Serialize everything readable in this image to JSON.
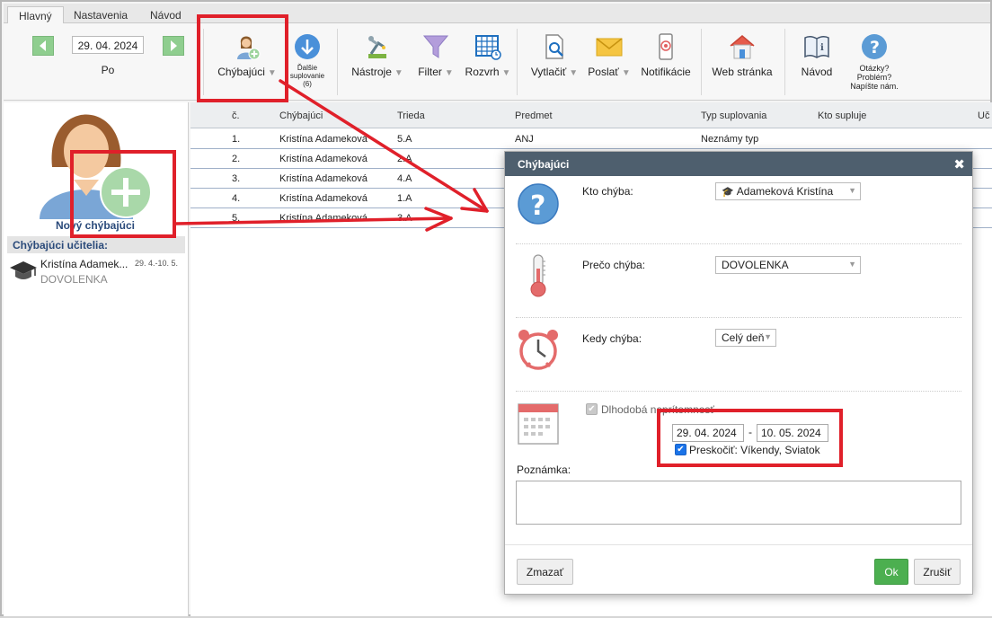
{
  "tabs": [
    "Hlavný",
    "Nastavenia",
    "Návod"
  ],
  "date_nav": {
    "date": "29. 04. 2024",
    "weekday": "Po"
  },
  "ribbon": {
    "chybajuci": "Chýbajúci",
    "dalsie_1": "Ďalšie",
    "dalsie_2": "suplovanie",
    "dalsie_3": "(6)",
    "nastroje": "Nástroje",
    "filter": "Filter",
    "rozvrh": "Rozvrh",
    "vytlacit": "Vytlačiť",
    "poslat": "Poslať",
    "notifikacie": "Notifikácie",
    "web": "Web stránka",
    "navod": "Návod",
    "otazky_1": "Otázky?",
    "otazky_2": "Problém?",
    "otazky_3": "Napíšte nám."
  },
  "left": {
    "new_label": "Nový chýbajúci",
    "section_title": "Chýbajúci učitelia:",
    "teacher_name": "Kristína Adamek...",
    "teacher_dates": "29. 4.-10. 5.",
    "teacher_reason": "DOVOLENKA"
  },
  "table": {
    "headers": [
      "č.",
      "Chýbajúci",
      "Trieda",
      "Predmet",
      "Typ suplovania",
      "Kto supluje",
      "Uč"
    ],
    "rows": [
      [
        "1.",
        "Kristína Adameková",
        "5.A",
        "ANJ",
        "Neznámy typ"
      ],
      [
        "2.",
        "Kristína Adameková",
        "2.A",
        "",
        ""
      ],
      [
        "3.",
        "Kristína Adameková",
        "4.A",
        "",
        ""
      ],
      [
        "4.",
        "Kristína Adameková",
        "1.A",
        "",
        ""
      ],
      [
        "5.",
        "Kristína Adameková",
        "3.A",
        "",
        ""
      ]
    ]
  },
  "dialog": {
    "title": "Chýbajúci",
    "close": "✖",
    "kto_label": "Kto chýba:",
    "kto_value": "Adameková Kristína",
    "preco_label": "Prečo chýba:",
    "preco_value": "DOVOLENKA",
    "kedy_label": "Kedy chýba:",
    "kedy_value": "Celý deň",
    "dlhodoba": "Dlhodobá neprítomnosť",
    "date_from": "29. 04. 2024",
    "date_dash": "-",
    "date_to": "10. 05. 2024",
    "preskocit": "Preskočiť: Víkendy, Sviatok",
    "poznamka": "Poznámka:",
    "poznamka_value": "",
    "zmazat": "Zmazať",
    "ok": "Ok",
    "zrusit": "Zrušiť"
  },
  "colors": {
    "accent_red": "#e0202a",
    "dialog_header": "#4e5f6e",
    "ok_green": "#4caf50",
    "nav_green": "#8fce8f"
  }
}
